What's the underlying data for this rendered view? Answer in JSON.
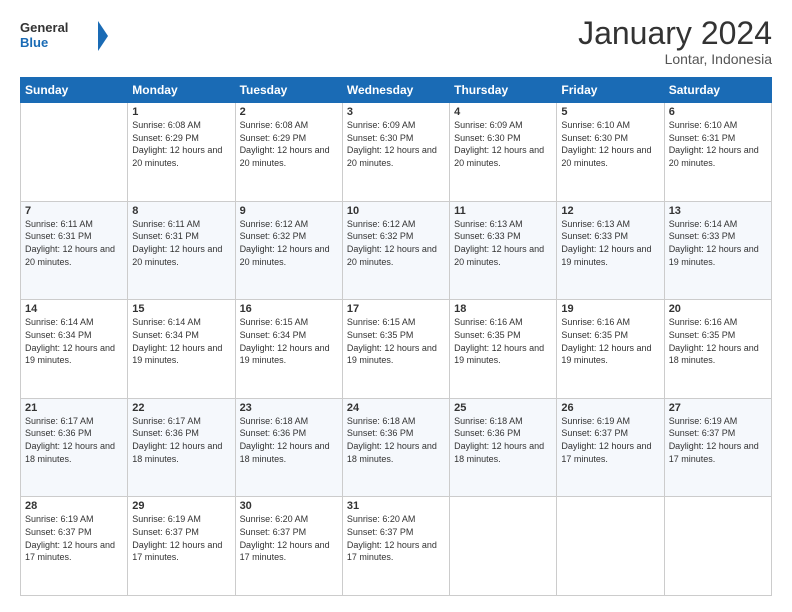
{
  "header": {
    "logo_general": "General",
    "logo_blue": "Blue",
    "title": "January 2024",
    "location": "Lontar, Indonesia"
  },
  "weekdays": [
    "Sunday",
    "Monday",
    "Tuesday",
    "Wednesday",
    "Thursday",
    "Friday",
    "Saturday"
  ],
  "weeks": [
    [
      {
        "day": "",
        "sunrise": "",
        "sunset": "",
        "daylight": ""
      },
      {
        "day": "1",
        "sunrise": "Sunrise: 6:08 AM",
        "sunset": "Sunset: 6:29 PM",
        "daylight": "Daylight: 12 hours and 20 minutes."
      },
      {
        "day": "2",
        "sunrise": "Sunrise: 6:08 AM",
        "sunset": "Sunset: 6:29 PM",
        "daylight": "Daylight: 12 hours and 20 minutes."
      },
      {
        "day": "3",
        "sunrise": "Sunrise: 6:09 AM",
        "sunset": "Sunset: 6:30 PM",
        "daylight": "Daylight: 12 hours and 20 minutes."
      },
      {
        "day": "4",
        "sunrise": "Sunrise: 6:09 AM",
        "sunset": "Sunset: 6:30 PM",
        "daylight": "Daylight: 12 hours and 20 minutes."
      },
      {
        "day": "5",
        "sunrise": "Sunrise: 6:10 AM",
        "sunset": "Sunset: 6:30 PM",
        "daylight": "Daylight: 12 hours and 20 minutes."
      },
      {
        "day": "6",
        "sunrise": "Sunrise: 6:10 AM",
        "sunset": "Sunset: 6:31 PM",
        "daylight": "Daylight: 12 hours and 20 minutes."
      }
    ],
    [
      {
        "day": "7",
        "sunrise": "Sunrise: 6:11 AM",
        "sunset": "Sunset: 6:31 PM",
        "daylight": "Daylight: 12 hours and 20 minutes."
      },
      {
        "day": "8",
        "sunrise": "Sunrise: 6:11 AM",
        "sunset": "Sunset: 6:31 PM",
        "daylight": "Daylight: 12 hours and 20 minutes."
      },
      {
        "day": "9",
        "sunrise": "Sunrise: 6:12 AM",
        "sunset": "Sunset: 6:32 PM",
        "daylight": "Daylight: 12 hours and 20 minutes."
      },
      {
        "day": "10",
        "sunrise": "Sunrise: 6:12 AM",
        "sunset": "Sunset: 6:32 PM",
        "daylight": "Daylight: 12 hours and 20 minutes."
      },
      {
        "day": "11",
        "sunrise": "Sunrise: 6:13 AM",
        "sunset": "Sunset: 6:33 PM",
        "daylight": "Daylight: 12 hours and 20 minutes."
      },
      {
        "day": "12",
        "sunrise": "Sunrise: 6:13 AM",
        "sunset": "Sunset: 6:33 PM",
        "daylight": "Daylight: 12 hours and 19 minutes."
      },
      {
        "day": "13",
        "sunrise": "Sunrise: 6:14 AM",
        "sunset": "Sunset: 6:33 PM",
        "daylight": "Daylight: 12 hours and 19 minutes."
      }
    ],
    [
      {
        "day": "14",
        "sunrise": "Sunrise: 6:14 AM",
        "sunset": "Sunset: 6:34 PM",
        "daylight": "Daylight: 12 hours and 19 minutes."
      },
      {
        "day": "15",
        "sunrise": "Sunrise: 6:14 AM",
        "sunset": "Sunset: 6:34 PM",
        "daylight": "Daylight: 12 hours and 19 minutes."
      },
      {
        "day": "16",
        "sunrise": "Sunrise: 6:15 AM",
        "sunset": "Sunset: 6:34 PM",
        "daylight": "Daylight: 12 hours and 19 minutes."
      },
      {
        "day": "17",
        "sunrise": "Sunrise: 6:15 AM",
        "sunset": "Sunset: 6:35 PM",
        "daylight": "Daylight: 12 hours and 19 minutes."
      },
      {
        "day": "18",
        "sunrise": "Sunrise: 6:16 AM",
        "sunset": "Sunset: 6:35 PM",
        "daylight": "Daylight: 12 hours and 19 minutes."
      },
      {
        "day": "19",
        "sunrise": "Sunrise: 6:16 AM",
        "sunset": "Sunset: 6:35 PM",
        "daylight": "Daylight: 12 hours and 19 minutes."
      },
      {
        "day": "20",
        "sunrise": "Sunrise: 6:16 AM",
        "sunset": "Sunset: 6:35 PM",
        "daylight": "Daylight: 12 hours and 18 minutes."
      }
    ],
    [
      {
        "day": "21",
        "sunrise": "Sunrise: 6:17 AM",
        "sunset": "Sunset: 6:36 PM",
        "daylight": "Daylight: 12 hours and 18 minutes."
      },
      {
        "day": "22",
        "sunrise": "Sunrise: 6:17 AM",
        "sunset": "Sunset: 6:36 PM",
        "daylight": "Daylight: 12 hours and 18 minutes."
      },
      {
        "day": "23",
        "sunrise": "Sunrise: 6:18 AM",
        "sunset": "Sunset: 6:36 PM",
        "daylight": "Daylight: 12 hours and 18 minutes."
      },
      {
        "day": "24",
        "sunrise": "Sunrise: 6:18 AM",
        "sunset": "Sunset: 6:36 PM",
        "daylight": "Daylight: 12 hours and 18 minutes."
      },
      {
        "day": "25",
        "sunrise": "Sunrise: 6:18 AM",
        "sunset": "Sunset: 6:36 PM",
        "daylight": "Daylight: 12 hours and 18 minutes."
      },
      {
        "day": "26",
        "sunrise": "Sunrise: 6:19 AM",
        "sunset": "Sunset: 6:37 PM",
        "daylight": "Daylight: 12 hours and 17 minutes."
      },
      {
        "day": "27",
        "sunrise": "Sunrise: 6:19 AM",
        "sunset": "Sunset: 6:37 PM",
        "daylight": "Daylight: 12 hours and 17 minutes."
      }
    ],
    [
      {
        "day": "28",
        "sunrise": "Sunrise: 6:19 AM",
        "sunset": "Sunset: 6:37 PM",
        "daylight": "Daylight: 12 hours and 17 minutes."
      },
      {
        "day": "29",
        "sunrise": "Sunrise: 6:19 AM",
        "sunset": "Sunset: 6:37 PM",
        "daylight": "Daylight: 12 hours and 17 minutes."
      },
      {
        "day": "30",
        "sunrise": "Sunrise: 6:20 AM",
        "sunset": "Sunset: 6:37 PM",
        "daylight": "Daylight: 12 hours and 17 minutes."
      },
      {
        "day": "31",
        "sunrise": "Sunrise: 6:20 AM",
        "sunset": "Sunset: 6:37 PM",
        "daylight": "Daylight: 12 hours and 17 minutes."
      },
      {
        "day": "",
        "sunrise": "",
        "sunset": "",
        "daylight": ""
      },
      {
        "day": "",
        "sunrise": "",
        "sunset": "",
        "daylight": ""
      },
      {
        "day": "",
        "sunrise": "",
        "sunset": "",
        "daylight": ""
      }
    ]
  ]
}
